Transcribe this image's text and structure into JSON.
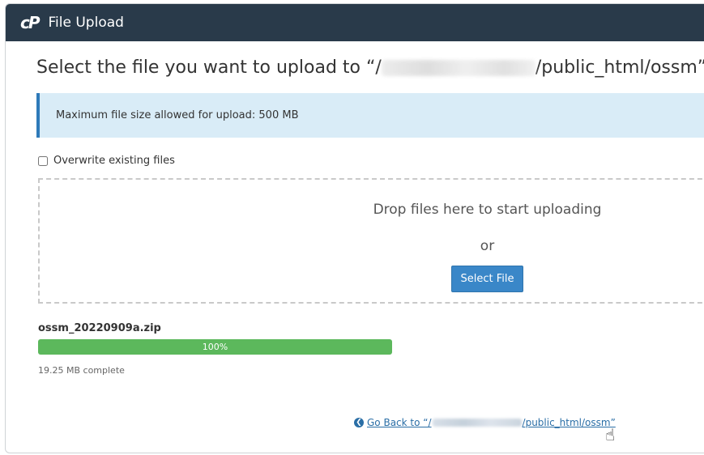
{
  "window": {
    "logo": "cP",
    "title": "File Upload"
  },
  "heading": {
    "prefix": "Select the file you want to upload to “/",
    "suffix": "/public_html/ossm”."
  },
  "info": {
    "text": "Maximum file size allowed for upload: 500 MB"
  },
  "overwrite": {
    "label": "Overwrite existing files",
    "checked": false
  },
  "dropzone": {
    "text": "Drop files here to start uploading",
    "or": "or",
    "button": "Select File"
  },
  "upload": {
    "filename": "ossm_20220909a.zip",
    "progress_label": "100%",
    "progress_value": 100,
    "status": "19.25 MB complete"
  },
  "goback": {
    "prefix": "Go Back to “/",
    "suffix": "/public_html/ossm”"
  },
  "colors": {
    "titlebar": "#293a4a",
    "info_bg": "#d9ecf7",
    "accent": "#3a87c8",
    "progress": "#5cb85c"
  }
}
